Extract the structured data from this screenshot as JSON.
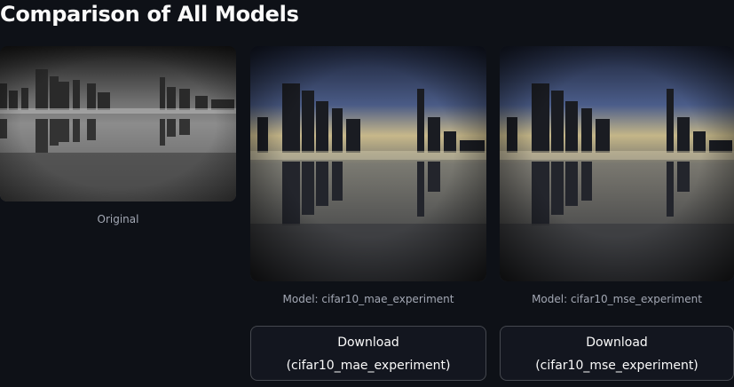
{
  "page": {
    "title": "Comparison of All Models"
  },
  "columns": [
    {
      "caption": "Original",
      "image_style": "grayscale"
    },
    {
      "caption": "Model: cifar10_mae_experiment",
      "image_style": "colorized",
      "download_line1": "Download",
      "download_line2": "(cifar10_mae_experiment)"
    },
    {
      "caption": "Model: cifar10_mse_experiment",
      "image_style": "colorized",
      "download_line1": "Download",
      "download_line2": "(cifar10_mse_experiment)"
    }
  ],
  "colors": {
    "background": "#0e1117",
    "text": "#fafafa",
    "caption": "#a3a8b4",
    "button_bg": "#13161f"
  }
}
